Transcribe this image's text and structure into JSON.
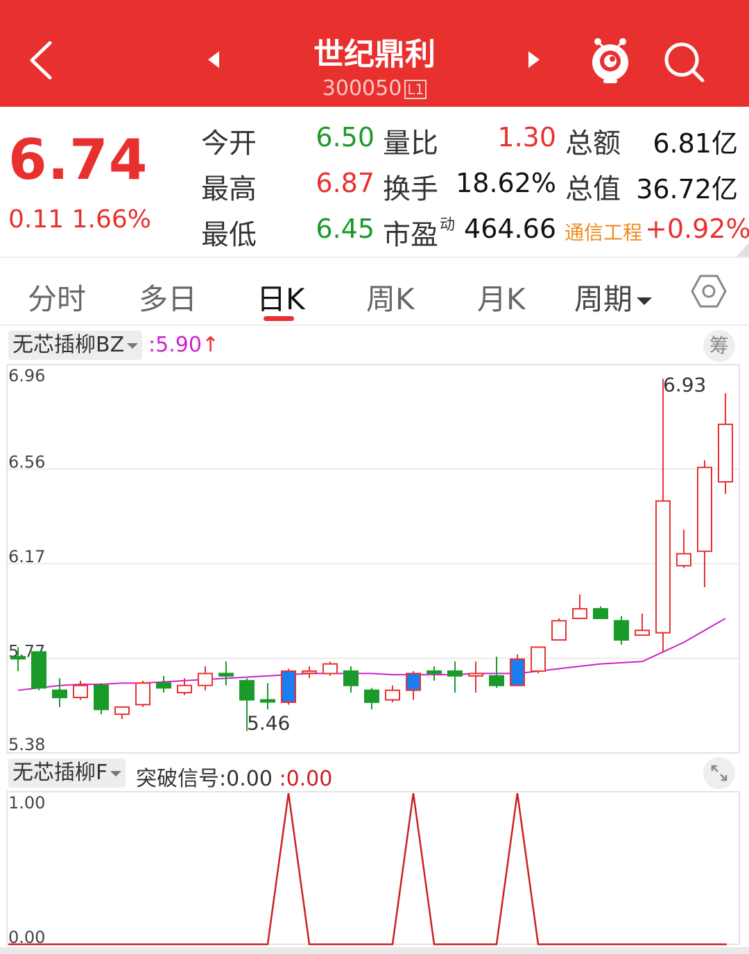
{
  "header": {
    "title": "世纪鼎利",
    "code": "300050",
    "level_badge": "L1",
    "back_icon": "back-arrow-icon",
    "prev_icon": "prev-stock-icon",
    "next_icon": "next-stock-icon",
    "mascot_icon": "mascot-icon",
    "search_icon": "search-icon",
    "bg_color": "#e8302f"
  },
  "quote": {
    "price": "6.74",
    "change": "0.11",
    "change_pct": "1.66%",
    "rows": [
      [
        {
          "label": "今开",
          "value": "6.50"
        },
        {
          "label": "量比",
          "value": "1.30"
        },
        {
          "label": "总额",
          "value": "6.81亿"
        }
      ],
      [
        {
          "label": "最高",
          "value": "6.87"
        },
        {
          "label": "换手",
          "value": "18.62%"
        },
        {
          "label": "总值",
          "value": "36.72亿"
        }
      ],
      [
        {
          "label": "最低",
          "value": "6.45"
        },
        {
          "label": "市盈",
          "label_sup": "动",
          "value": "464.66"
        },
        {
          "label": "通信工程",
          "value": "+0.92%"
        }
      ]
    ]
  },
  "tabs": {
    "items": [
      "分时",
      "多日",
      "日K",
      "周K",
      "月K",
      "周期"
    ],
    "active": "日K",
    "settings_icon": "hexagon-settings-icon"
  },
  "kline_panel": {
    "indicator": "无芯插柳BZ",
    "indicator_value": "5.90",
    "indicator_arrow": "↑",
    "chip_button": "筹",
    "y_labels": [
      "6.96",
      "6.56",
      "6.17",
      "5.77",
      "5.38"
    ],
    "high_marker": "6.93",
    "low_marker": "5.46",
    "up_color": "#e8302f",
    "down_color": "#1a9a28",
    "signal_color": "#1a7ef0",
    "ma_color": "#cc22cc"
  },
  "chart_data": [
    {
      "type": "candlestick",
      "ylim": [
        5.38,
        6.96
      ],
      "candles": [
        {
          "o": 5.77,
          "c": 5.77,
          "h": 5.81,
          "l": 5.71,
          "dir": "down"
        },
        {
          "o": 5.79,
          "c": 5.64,
          "h": 5.79,
          "l": 5.63,
          "dir": "down"
        },
        {
          "o": 5.63,
          "c": 5.6,
          "h": 5.68,
          "l": 5.56,
          "dir": "down"
        },
        {
          "o": 5.6,
          "c": 5.65,
          "h": 5.67,
          "l": 5.59,
          "dir": "up"
        },
        {
          "o": 5.65,
          "c": 5.55,
          "h": 5.66,
          "l": 5.53,
          "dir": "down"
        },
        {
          "o": 5.53,
          "c": 5.56,
          "h": 5.56,
          "l": 5.51,
          "dir": "up"
        },
        {
          "o": 5.57,
          "c": 5.66,
          "h": 5.67,
          "l": 5.56,
          "dir": "up"
        },
        {
          "o": 5.66,
          "c": 5.64,
          "h": 5.69,
          "l": 5.62,
          "dir": "down"
        },
        {
          "o": 5.62,
          "c": 5.65,
          "h": 5.68,
          "l": 5.61,
          "dir": "up"
        },
        {
          "o": 5.65,
          "c": 5.7,
          "h": 5.73,
          "l": 5.63,
          "dir": "up"
        },
        {
          "o": 5.7,
          "c": 5.69,
          "h": 5.75,
          "l": 5.65,
          "dir": "down"
        },
        {
          "o": 5.67,
          "c": 5.59,
          "h": 5.68,
          "l": 5.46,
          "dir": "down"
        },
        {
          "o": 5.59,
          "c": 5.59,
          "h": 5.66,
          "l": 5.55,
          "dir": "down"
        },
        {
          "o": 5.58,
          "c": 5.71,
          "h": 5.72,
          "l": 5.57,
          "dir": "signal"
        },
        {
          "o": 5.71,
          "c": 5.71,
          "h": 5.73,
          "l": 5.68,
          "dir": "up"
        },
        {
          "o": 5.7,
          "c": 5.74,
          "h": 5.75,
          "l": 5.69,
          "dir": "up"
        },
        {
          "o": 5.71,
          "c": 5.65,
          "h": 5.73,
          "l": 5.62,
          "dir": "down"
        },
        {
          "o": 5.63,
          "c": 5.58,
          "h": 5.64,
          "l": 5.55,
          "dir": "down"
        },
        {
          "o": 5.59,
          "c": 5.63,
          "h": 5.65,
          "l": 5.58,
          "dir": "up"
        },
        {
          "o": 5.63,
          "c": 5.7,
          "h": 5.71,
          "l": 5.59,
          "dir": "signal"
        },
        {
          "o": 5.71,
          "c": 5.71,
          "h": 5.73,
          "l": 5.67,
          "dir": "down"
        },
        {
          "o": 5.71,
          "c": 5.69,
          "h": 5.75,
          "l": 5.62,
          "dir": "down"
        },
        {
          "o": 5.69,
          "c": 5.7,
          "h": 5.75,
          "l": 5.62,
          "dir": "up"
        },
        {
          "o": 5.69,
          "c": 5.65,
          "h": 5.77,
          "l": 5.64,
          "dir": "down"
        },
        {
          "o": 5.65,
          "c": 5.76,
          "h": 5.78,
          "l": 5.65,
          "dir": "signal"
        },
        {
          "o": 5.71,
          "c": 5.81,
          "h": 5.81,
          "l": 5.7,
          "dir": "up"
        },
        {
          "o": 5.84,
          "c": 5.92,
          "h": 5.93,
          "l": 5.84,
          "dir": "up"
        },
        {
          "o": 5.93,
          "c": 5.97,
          "h": 6.03,
          "l": 5.93,
          "dir": "up"
        },
        {
          "o": 5.97,
          "c": 5.93,
          "h": 5.98,
          "l": 5.93,
          "dir": "down"
        },
        {
          "o": 5.92,
          "c": 5.84,
          "h": 5.94,
          "l": 5.82,
          "dir": "down"
        },
        {
          "o": 5.86,
          "c": 5.88,
          "h": 5.95,
          "l": 5.86,
          "dir": "up"
        },
        {
          "o": 5.87,
          "c": 6.42,
          "h": 6.93,
          "l": 5.79,
          "dir": "up"
        },
        {
          "o": 6.15,
          "c": 6.2,
          "h": 6.3,
          "l": 6.14,
          "dir": "up"
        },
        {
          "o": 6.21,
          "c": 6.56,
          "h": 6.59,
          "l": 6.06,
          "dir": "up"
        },
        {
          "o": 6.5,
          "c": 6.74,
          "h": 6.87,
          "l": 6.45,
          "dir": "up"
        }
      ],
      "ma": [
        5.63,
        5.64,
        5.65,
        5.655,
        5.655,
        5.66,
        5.66,
        5.665,
        5.67,
        5.675,
        5.68,
        5.685,
        5.69,
        5.695,
        5.7,
        5.7,
        5.7,
        5.7,
        5.695,
        5.695,
        5.695,
        5.695,
        5.7,
        5.7,
        5.7,
        5.71,
        5.72,
        5.73,
        5.74,
        5.745,
        5.75,
        5.79,
        5.83,
        5.88,
        5.93
      ]
    },
    {
      "type": "line",
      "ylim": [
        0,
        1
      ],
      "values": [
        0,
        0,
        0,
        0,
        0,
        0,
        0,
        0,
        0,
        0,
        0,
        0,
        0,
        1,
        0,
        0,
        0,
        0,
        0,
        1,
        0,
        0,
        0,
        0,
        1,
        0,
        0,
        0,
        0,
        0,
        0,
        0,
        0,
        0,
        0
      ],
      "color": "#cc1f1f"
    }
  ],
  "signal_panel": {
    "indicator": "无芯插柳F",
    "signal_label": "突破信号:",
    "signal_value": "0.00",
    "current_value": "0.00",
    "expand_icon": "expand-icon",
    "y_labels": [
      "1.00",
      "0.00"
    ]
  }
}
